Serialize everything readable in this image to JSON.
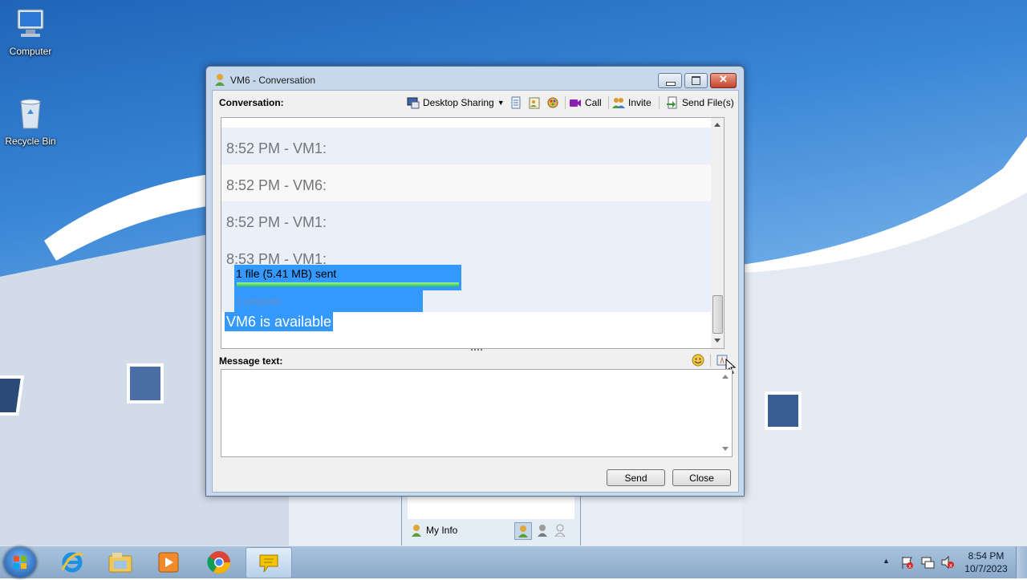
{
  "desktop": {
    "icons": [
      {
        "label": "Computer"
      },
      {
        "label": "Recycle Bin"
      }
    ]
  },
  "window": {
    "title": "VM6 - Conversation",
    "conversation_label": "Conversation:",
    "toolbar": {
      "desktop_sharing": "Desktop Sharing",
      "call": "Call",
      "invite": "Invite",
      "send_files": "Send File(s)"
    },
    "history": {
      "messages": [
        {
          "text": "8:52 PM - VM1:"
        },
        {
          "text": "8:52 PM - VM6:"
        },
        {
          "text": "8:52 PM - VM1:"
        },
        {
          "text": "8:53 PM - VM1:"
        }
      ],
      "file_transfer": {
        "text": "1 file (5.41 MB) sent",
        "progress": 1.0,
        "status": "Complete"
      },
      "presence": "VM6 is available"
    },
    "message_label": "Message text:",
    "send_label": "Send",
    "close_label": "Close"
  },
  "behind_panel": {
    "my_info": "My Info"
  },
  "taskbar": {
    "apps": [
      {
        "icon": "internet-explorer-icon"
      },
      {
        "icon": "file-explorer-icon"
      },
      {
        "icon": "media-player-icon"
      },
      {
        "icon": "chrome-icon"
      },
      {
        "icon": "messenger-icon"
      }
    ],
    "clock": {
      "time": "8:54 PM",
      "date": "10/7/2023"
    }
  },
  "colors": {
    "selection": "#3399ff",
    "progress": "#2ecc40"
  }
}
